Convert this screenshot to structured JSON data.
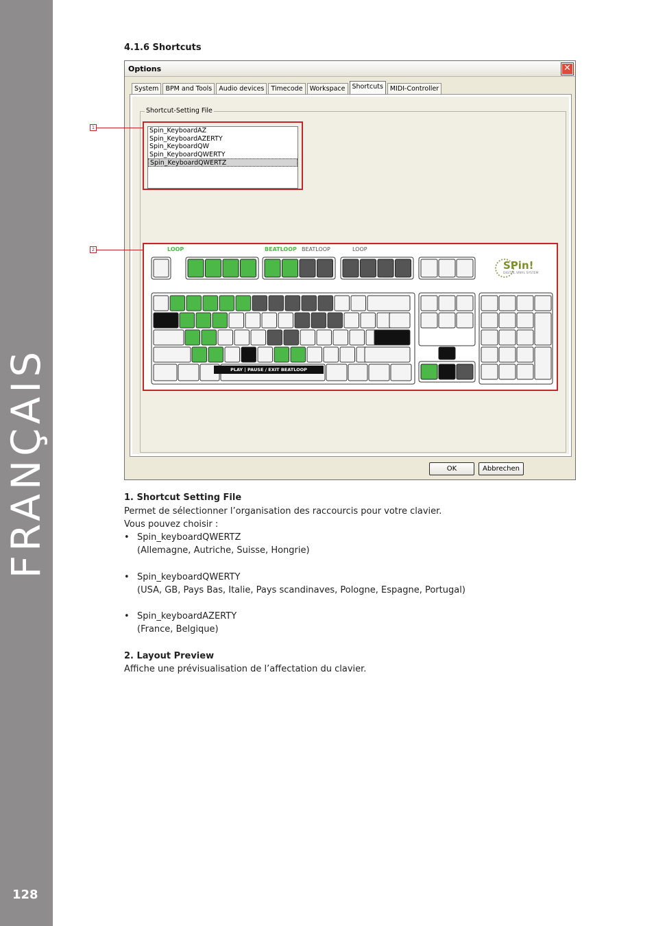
{
  "sidebar": {
    "title": "FRANÇAIS",
    "page_number": "128"
  },
  "section_title": "4.1.6 Shortcuts",
  "dialog": {
    "title": "Options",
    "tabs": [
      "System",
      "BPM and Tools",
      "Audio devices",
      "Timecode",
      "Workspace",
      "Shortcuts",
      "MIDI-Controller"
    ],
    "active_tab": "Shortcuts",
    "group_label": "Shortcut-Setting File",
    "files": [
      "Spin_KeyboardAZ",
      "Spin_KeyboardAZERTY",
      "Spin_KeyboardQW",
      "Spin_KeyboardQWERTY",
      "Spin_KeyboardQWERTZ"
    ],
    "selected_file": "Spin_KeyboardQWERTZ",
    "ok_label": "OK",
    "cancel_label": "Abbrechen"
  },
  "callouts": [
    "1",
    "2"
  ],
  "keyboard": {
    "group_labels": [
      "LOOP",
      "BEATLOOP",
      "BEATLOOP",
      "LOOP"
    ],
    "logo_text": "SPin!",
    "logo_sub": "DIGITAL VINYL SYSTEM",
    "space_label": "PLAY | PAUSE / EXIT BEATLOOP",
    "accent_green": "#4cb848",
    "key_fill": "#f4f4f4"
  },
  "text": {
    "h1": "1. Shortcut Setting File",
    "p1": "Permet de sélectionner l’organisation des raccourcis pour votre clavier.",
    "p2": "Vous pouvez choisir :",
    "b1": "Spin_keyboardQWERTZ",
    "b1_sub": "(Allemagne, Autriche, Suisse, Hongrie)",
    "b2": "Spin_keyboardQWERTY",
    "b2_sub": "(USA, GB, Pays Bas, Italie, Pays scandinaves, Pologne, Espagne, Portugal)",
    "b3": "Spin_keyboardAZERTY",
    "b3_sub": "(France, Belgique)",
    "h2": "2. Layout Preview",
    "p3": "Affiche une prévisualisation de l’affectation du clavier.",
    "bullet_char": "•"
  }
}
